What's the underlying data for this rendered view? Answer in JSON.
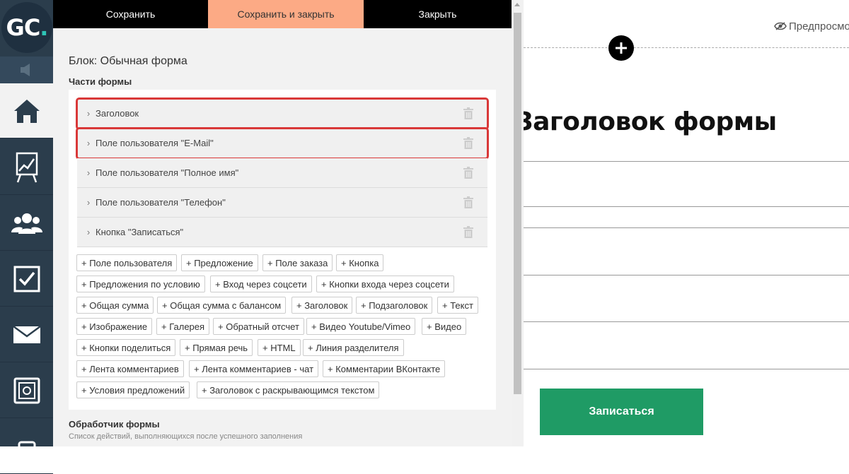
{
  "logo": {
    "text": "GC",
    "dot": "."
  },
  "nav": {
    "items": [
      {
        "icon": "home-icon"
      },
      {
        "icon": "chart-icon"
      },
      {
        "icon": "users-icon"
      },
      {
        "icon": "checkbox-icon"
      },
      {
        "icon": "mail-icon"
      },
      {
        "icon": "safe-icon"
      },
      {
        "icon": "mobile-icon"
      }
    ]
  },
  "toolbar": {
    "save_label": "Сохранить",
    "save_close_label": "Сохранить и закрыть",
    "close_label": "Закрыть"
  },
  "panel": {
    "block_title": "Блок: Обычная форма",
    "parts_title": "Части формы",
    "parts": [
      {
        "label": "Заголовок",
        "highlighted": true
      },
      {
        "label": "Поле пользователя \"E-Mail\"",
        "highlighted": true
      },
      {
        "label": "Поле пользователя \"Полное имя\"",
        "highlighted": false
      },
      {
        "label": "Поле пользователя \"Телефон\"",
        "highlighted": false
      },
      {
        "label": "Кнопка \"Записаться\"",
        "highlighted": false
      }
    ],
    "add_buttons": [
      [
        "+ Поле пользователя",
        "+ Предложение",
        "+ Поле заказа",
        "+ Кнопка"
      ],
      [
        "+ Предложения по условию",
        "+ Вход через соцсети",
        "+ Кнопки входа через соцсети"
      ],
      [
        "+ Общая сумма",
        "+ Общая сумма с балансом",
        "+ Заголовок",
        "+ Подзаголовок",
        "+ Текст"
      ],
      [
        "+ Изображение",
        "+ Галерея",
        "+ Обратный отсчет",
        "+ Видео Youtube/Vimeo",
        "+ Видео"
      ],
      [
        "+ Кнопки поделиться",
        "+ Прямая речь",
        "+ HTML",
        "+ Линия разделителя"
      ],
      [
        "+ Лента комментариев",
        "+ Лента комментариев - чат",
        "+ Комментарии ВКонтакте"
      ],
      [
        "+ Условия предложений",
        "+ Заголовок с раскрывающимся текстом"
      ]
    ],
    "handler_title": "Обработчик формы",
    "handler_subtitle": "Список действий, выполняющихся после успешного заполнения"
  },
  "preview": {
    "preview_link": "Предпросмотр",
    "form_title": "Заголовок формы",
    "submit_label": "Записаться",
    "submit_color": "#1f9b65"
  },
  "colors": {
    "nav_bg": "#2b3d4c",
    "accent_tab": "#fcaa85",
    "highlight_outline": "#d93838"
  }
}
